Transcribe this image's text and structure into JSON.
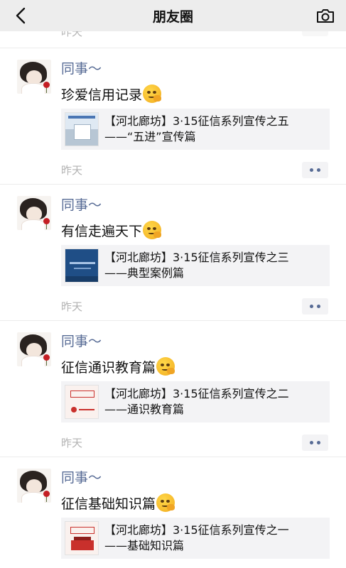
{
  "nav": {
    "title": "朋友圈",
    "back_icon": "chevron-left-icon",
    "camera_icon": "camera-icon"
  },
  "previous_post": {
    "timestamp": "昨天"
  },
  "posts": [
    {
      "author": "同事～",
      "text": "珍爱信用记录",
      "link": {
        "title_line1": "【河北廊坊】3·15征信系列宣传之五",
        "title_line2": "——“五进”宣传篇"
      },
      "timestamp": "昨天"
    },
    {
      "author": "同事～",
      "text": "有信走遍天下",
      "link": {
        "title_line1": "【河北廊坊】3·15征信系列宣传之三",
        "title_line2": "——典型案例篇"
      },
      "timestamp": "昨天"
    },
    {
      "author": "同事～",
      "text": "征信通识教育篇",
      "link": {
        "title_line1": "【河北廊坊】3·15征信系列宣传之二",
        "title_line2": "——通识教育篇"
      },
      "timestamp": "昨天"
    },
    {
      "author": "同事～",
      "text": "征信基础知识篇",
      "link": {
        "title_line1": "【河北廊坊】3·15征信系列宣传之一",
        "title_line2": "——基础知识篇"
      },
      "timestamp": "昨天"
    }
  ],
  "colors": {
    "author_name": "#576b95",
    "timestamp": "#b2b2b2",
    "link_card_bg": "#f3f3f5",
    "nav_bg": "#ededed"
  }
}
